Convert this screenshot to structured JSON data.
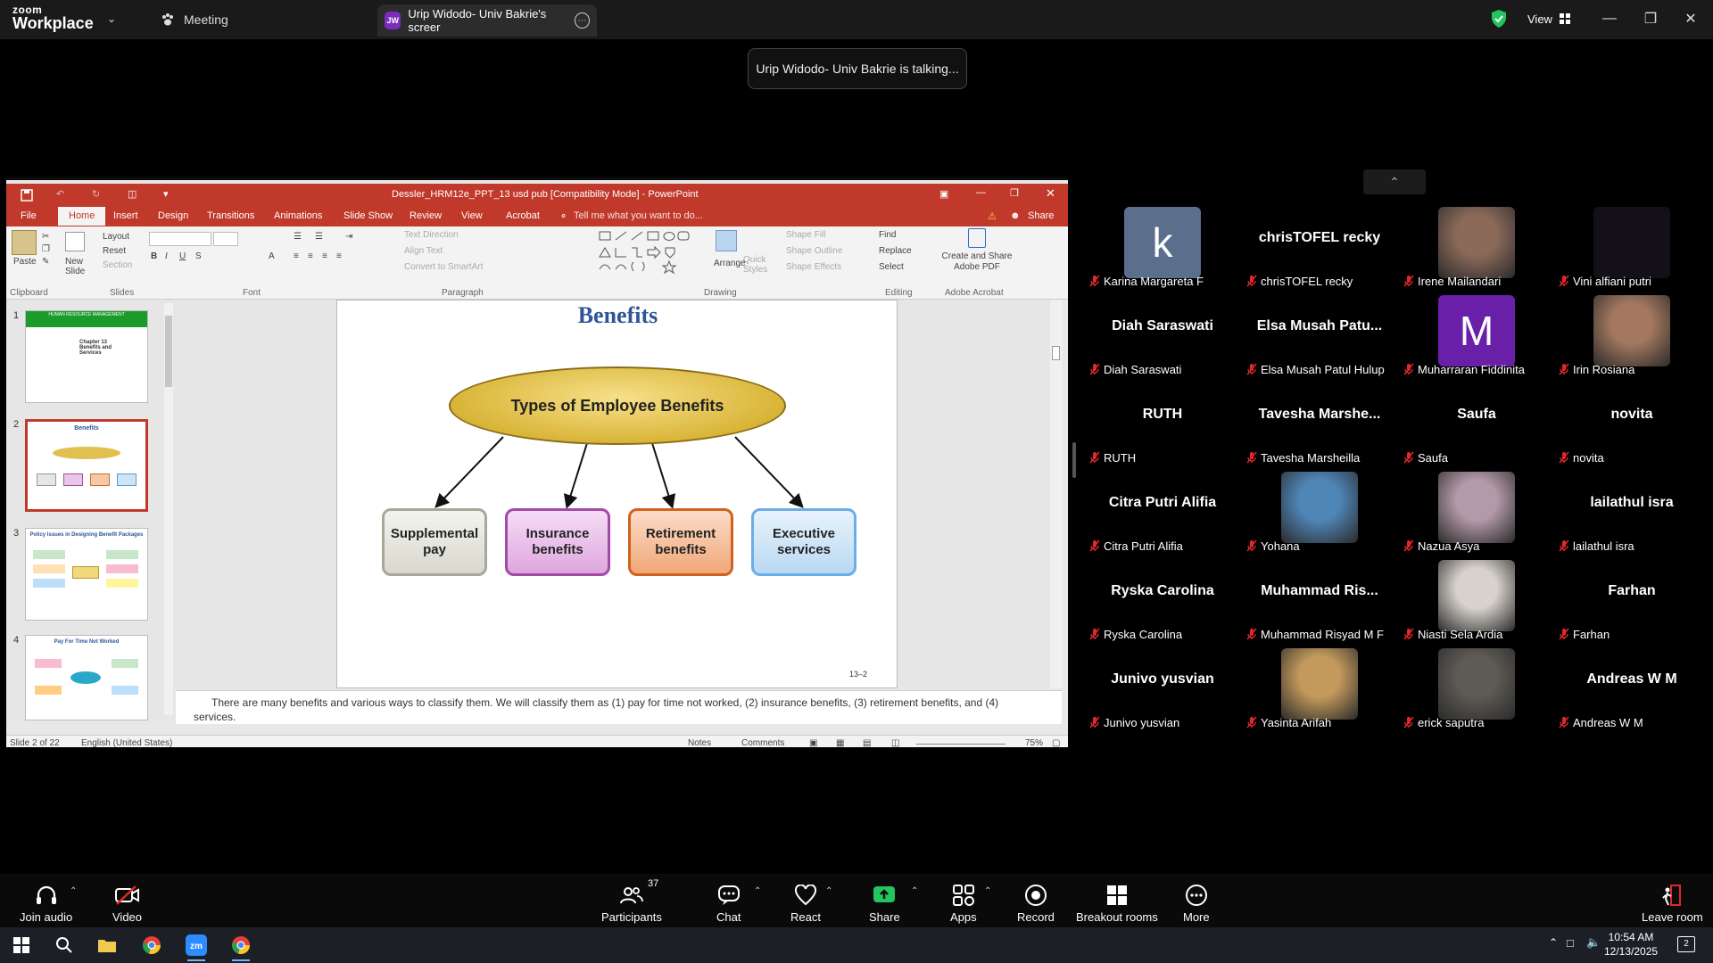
{
  "app": {
    "logo_line1": "zoom",
    "logo_line2": "Workplace",
    "meeting_tab": "Meeting",
    "share_tab_initials": "JW",
    "share_tab_title": "Urip Widodo- Univ Bakrie's screer",
    "view_label": "View",
    "talking_toast": "Urip Widodo- Univ Bakrie is talking...",
    "security_color": "#22c55e"
  },
  "powerpoint": {
    "window_title": "Dessler_HRM12e_PPT_13 usd pub [Compatibility Mode] - PowerPoint",
    "tabs": [
      "File",
      "Home",
      "Insert",
      "Design",
      "Transitions",
      "Animations",
      "Slide Show",
      "Review",
      "View",
      "Acrobat"
    ],
    "tell_me": "Tell me what you want to do...",
    "share_label": "Share",
    "ribbon": {
      "paste": "Paste",
      "layout": "Layout",
      "reset": "Reset",
      "new_slide": "New Slide",
      "section": "Section",
      "text_direction": "Text Direction",
      "align_text": "Align Text",
      "convert_smartart": "Convert to SmartArt",
      "arrange": "Arrange",
      "quick_styles": "Quick Styles",
      "shape_fill": "Shape Fill",
      "shape_outline": "Shape Outline",
      "shape_effects": "Shape Effects",
      "find": "Find",
      "replace": "Replace",
      "select": "Select",
      "create_share_pdf": "Create and Share Adobe PDF",
      "group_labels": [
        "Clipboard",
        "Slides",
        "Font",
        "Paragraph",
        "Drawing",
        "Editing",
        "Adobe Acrobat"
      ]
    },
    "thumbnails": [
      {
        "num": "1",
        "title": "HUMAN RESOURCE MANAGEMENT",
        "sub": "Chapter 13 Benefits and Services"
      },
      {
        "num": "2",
        "title": "Benefits"
      },
      {
        "num": "3",
        "title": "Policy Issues in Designing Benefit Packages"
      },
      {
        "num": "4",
        "title": "Pay For Time Not Worked"
      }
    ],
    "slide": {
      "title": "Benefits",
      "center": "Types of Employee Benefits",
      "boxes": [
        "Supplemental pay",
        "Insurance benefits",
        "Retirement benefits",
        "Executive services"
      ],
      "number": "13–2"
    },
    "notes": "There are many benefits and various ways to classify them. We will classify them as (1) pay for time not worked, (2) insurance benefits, (3) retirement benefits, and (4) services.",
    "status": {
      "slide_of": "Slide 2 of 22",
      "language": "English (United States)",
      "notes": "Notes",
      "comments": "Comments",
      "zoom": "75%"
    }
  },
  "participants": [
    {
      "name": "Karina Margareta F",
      "display": "",
      "avatar": "letter",
      "letter": "k",
      "color": "#5b6e8c"
    },
    {
      "name": "chrisTOFEL recky",
      "display": "chrisTOFEL recky",
      "avatar": "none"
    },
    {
      "name": "Irene Mailandari",
      "display": "",
      "avatar": "photo",
      "color": "#8c6a5a"
    },
    {
      "name": "Vini alfiani putri",
      "display": "",
      "avatar": "dark",
      "color": "#141018"
    },
    {
      "name": "Diah Saraswati",
      "display": "Diah Saraswati",
      "avatar": "none"
    },
    {
      "name": "Elsa Musah Patul Hulup",
      "display": "Elsa Musah Patu...",
      "avatar": "none"
    },
    {
      "name": "Muharraran Fiddinita",
      "display": "",
      "avatar": "letter",
      "letter": "M",
      "color": "#6a1fa8"
    },
    {
      "name": "Irin Rosiana",
      "display": "",
      "avatar": "photo",
      "color": "#a3785f"
    },
    {
      "name": "RUTH",
      "display": "RUTH",
      "avatar": "none"
    },
    {
      "name": "Tavesha Marsheilla",
      "display": "Tavesha Marshe...",
      "avatar": "none"
    },
    {
      "name": "Saufa",
      "display": "Saufa",
      "avatar": "none"
    },
    {
      "name": "novita",
      "display": "novita",
      "avatar": "none"
    },
    {
      "name": "Citra Putri Alifia",
      "display": "Citra Putri Alifia",
      "avatar": "none"
    },
    {
      "name": "Yohana",
      "display": "",
      "avatar": "photo",
      "color": "#4f86b8"
    },
    {
      "name": "Nazua Asya",
      "display": "",
      "avatar": "photo",
      "color": "#b39aa8"
    },
    {
      "name": "lailathul isra",
      "display": "lailathul isra",
      "avatar": "none"
    },
    {
      "name": "Ryska  Carolina",
      "display": "Ryska  Carolina",
      "avatar": "none"
    },
    {
      "name": "Muhammad Risyad M F",
      "display": "Muhammad Ris...",
      "avatar": "none"
    },
    {
      "name": "Niasti Sela Ardia",
      "display": "",
      "avatar": "photo",
      "color": "#d8d2cc"
    },
    {
      "name": "Farhan",
      "display": "Farhan",
      "avatar": "none"
    },
    {
      "name": "Junivo yusvian",
      "display": "Junivo yusvian",
      "avatar": "none"
    },
    {
      "name": "Yasinta Arifah",
      "display": "",
      "avatar": "photo",
      "color": "#c49a5c"
    },
    {
      "name": "erick saputra",
      "display": "",
      "avatar": "photo",
      "color": "#5e5a55"
    },
    {
      "name": "Andreas W M",
      "display": "Andreas W M",
      "avatar": "none"
    }
  ],
  "toolbar": {
    "join_audio": "Join audio",
    "video": "Video",
    "participants": "Participants",
    "participants_count": "37",
    "chat": "Chat",
    "react": "React",
    "share": "Share",
    "apps": "Apps",
    "record": "Record",
    "breakout": "Breakout rooms",
    "more": "More",
    "leave": "Leave room",
    "share_color": "#22c55e",
    "video_off_color": "#e02828"
  },
  "taskbar": {
    "time": "10:54 AM",
    "date": "12/13/2025",
    "notification_count": "2"
  }
}
